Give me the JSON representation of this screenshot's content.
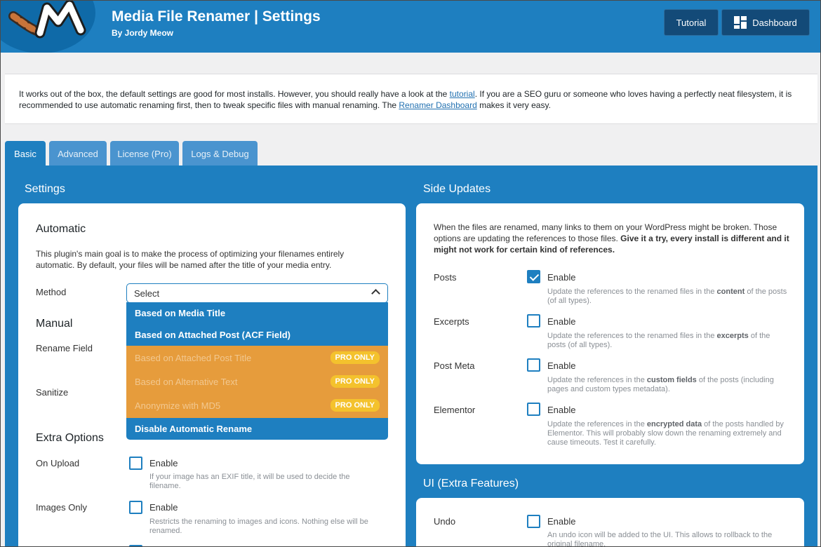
{
  "header": {
    "title": "Media File Renamer | Settings",
    "subtitle": "By Jordy Meow",
    "tutorial_label": "Tutorial",
    "dashboard_label": "Dashboard",
    "brand_color": "#1e7fc0"
  },
  "notice": {
    "text_1": "It works out of the box, the default settings are good for most installs. However, you should really have a look at the ",
    "link_tutorial": "tutorial",
    "text_2": ". If you are a SEO guru or someone who loves having a perfectly neat filesystem, it is recommended to use automatic renaming first, then to tweak specific files with manual renaming. The ",
    "link_dashboard": "Renamer Dashboard",
    "text_3": " makes it very easy."
  },
  "tabs": [
    {
      "label": "Basic",
      "active": true
    },
    {
      "label": "Advanced",
      "active": false
    },
    {
      "label": "License (Pro)",
      "active": false
    },
    {
      "label": "Logs & Debug",
      "active": false
    }
  ],
  "settings": {
    "section_title": "Settings",
    "automatic_title": "Automatic",
    "automatic_desc": "This plugin's main goal is to make the process of optimizing your filenames entirely automatic. By default, your files will be named after the title of your media entry.",
    "method_label": "Method",
    "select_value": "Select",
    "options": [
      {
        "label": "Based on Media Title",
        "pro": false
      },
      {
        "label": "Based on Attached Post (ACF Field)",
        "pro": false
      },
      {
        "label": "Based on Attached Post Title",
        "pro": true
      },
      {
        "label": "Based on Alternative Text",
        "pro": true
      },
      {
        "label": "Anonymize with MD5",
        "pro": true
      },
      {
        "label": "Disable Automatic Rename",
        "pro": false
      }
    ],
    "pro_badge": "PRO ONLY",
    "manual_title": "Manual",
    "rename_field_label": "Rename Field",
    "sanitize_label": "Sanitize",
    "extra_title": "Extra Options",
    "on_upload_label": "On Upload",
    "on_upload_enable": "Enable",
    "on_upload_desc": "If your image has an EXIF title, it will be used to decide the filename.",
    "images_only_label": "Images Only",
    "images_only_enable": "Enable",
    "images_only_desc": "Restricts the renaming to images and icons. Nothing else will be renamed."
  },
  "side_updates": {
    "section_title": "Side Updates",
    "intro": "When the files are renamed, many links to them on your WordPress might be broken. Those options are updating the references to those files. ",
    "intro_bold": "Give it a try, every install is different and it might not work for certain kind of references.",
    "rows": [
      {
        "label": "Posts",
        "enable": "Enable",
        "checked": true,
        "desc_1": "Update the references to the renamed files in the ",
        "desc_bold": "content",
        "desc_2": " of the posts (of all types)."
      },
      {
        "label": "Excerpts",
        "enable": "Enable",
        "checked": false,
        "desc_1": "Update the references to the renamed files in the ",
        "desc_bold": "excerpts",
        "desc_2": " of the posts (of all types)."
      },
      {
        "label": "Post Meta",
        "enable": "Enable",
        "checked": false,
        "desc_1": "Update the references in the ",
        "desc_bold": "custom fields",
        "desc_2": " of the posts (including pages and custom types metadata)."
      },
      {
        "label": "Elementor",
        "enable": "Enable",
        "checked": false,
        "desc_1": "Update the references in the ",
        "desc_bold": "encrypted data",
        "desc_2": " of the posts handled by Elementor. This will probably slow down the renaming extremely and cause timeouts. Test it carefully."
      }
    ]
  },
  "ui_extra": {
    "section_title": "UI (Extra Features)",
    "undo_label": "Undo",
    "undo_enable": "Enable",
    "undo_desc": "An undo icon will be added to the UI. This allows to rollback to the original filename."
  }
}
